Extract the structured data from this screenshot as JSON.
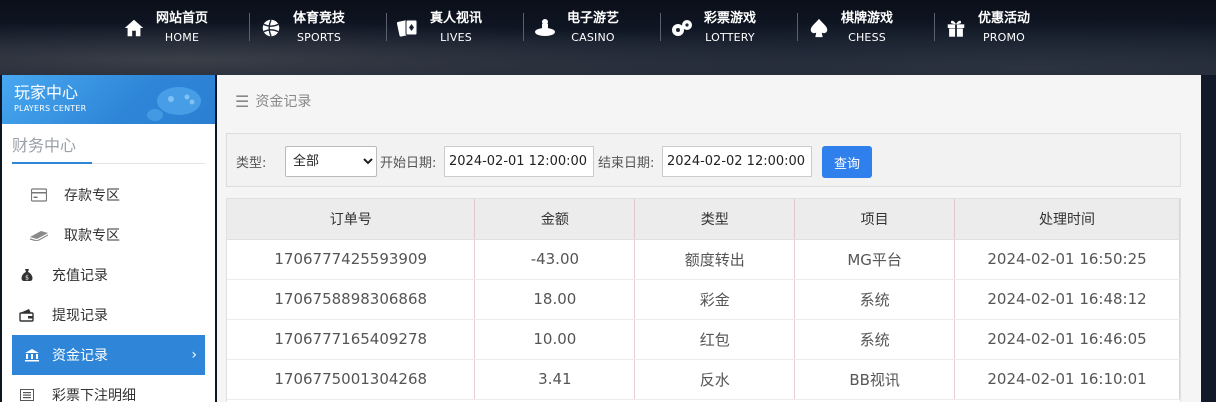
{
  "nav": {
    "items": [
      {
        "cn": "网站首页",
        "en": "HOME",
        "icon": "home-icon"
      },
      {
        "cn": "体育竞技",
        "en": "SPORTS",
        "icon": "basketball-icon"
      },
      {
        "cn": "真人视讯",
        "en": "LIVES",
        "icon": "cards-icon"
      },
      {
        "cn": "电子游艺",
        "en": "CASINO",
        "icon": "slot-icon"
      },
      {
        "cn": "彩票游戏",
        "en": "LOTTERY",
        "icon": "lottery-balls-icon"
      },
      {
        "cn": "棋牌游戏",
        "en": "CHESS",
        "icon": "spade-icon"
      },
      {
        "cn": "优惠活动",
        "en": "PROMO",
        "icon": "gift-icon"
      }
    ]
  },
  "sidebar": {
    "header_cn": "玩家中心",
    "header_en": "PLAYERS CENTER",
    "section_title": "财务中心",
    "items": [
      {
        "label": "存款专区",
        "icon": "deposit-card-icon"
      },
      {
        "label": "取款专区",
        "icon": "withdraw-cash-icon"
      },
      {
        "label": "充值记录",
        "icon": "money-bag-icon"
      },
      {
        "label": "提现记录",
        "icon": "wallet-icon"
      },
      {
        "label": "资金记录",
        "icon": "bank-icon",
        "active": true
      },
      {
        "label": "彩票下注明细",
        "icon": "list-icon"
      }
    ],
    "active_chevron": "›"
  },
  "breadcrumb": {
    "icon": "☰",
    "text": "资金记录"
  },
  "filter": {
    "type_label": "类型:",
    "type_value": "全部",
    "start_label": "开始日期:",
    "start_value": "2024-02-01 12:00:00",
    "end_label": "结束日期:",
    "end_value": "2024-02-02 12:00:00",
    "query_label": "查询"
  },
  "table": {
    "headers": [
      "订单号",
      "金额",
      "类型",
      "项目",
      "处理时间"
    ],
    "rows": [
      [
        "1706777425593909",
        "-43.00",
        "额度转出",
        "MG平台",
        "2024-02-01 16:50:25"
      ],
      [
        "1706758898306868",
        "18.00",
        "彩金",
        "系统",
        "2024-02-01 16:48:12"
      ],
      [
        "1706777165409278",
        "10.00",
        "红包",
        "系统",
        "2024-02-01 16:46:05"
      ],
      [
        "1706775001304268",
        "3.41",
        "反水",
        "BB视讯",
        "2024-02-01 16:10:01"
      ]
    ]
  },
  "colors": {
    "accent": "#2f86d8",
    "button": "#2f80ed"
  }
}
